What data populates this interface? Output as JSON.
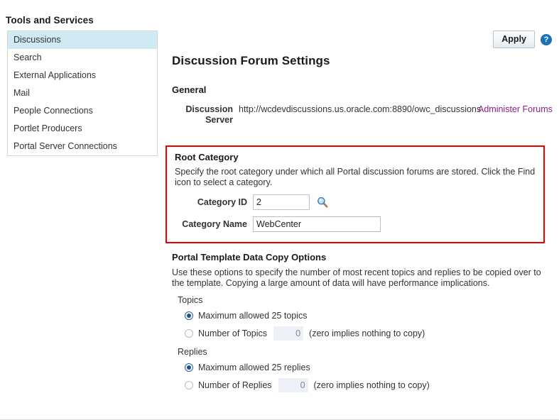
{
  "panel": {
    "title": "Tools and Services",
    "collapse_icon": "collapse-chevron-icon",
    "items": [
      {
        "label": "Discussions",
        "selected": true
      },
      {
        "label": "Search",
        "selected": false
      },
      {
        "label": "External Applications",
        "selected": false
      },
      {
        "label": "Mail",
        "selected": false
      },
      {
        "label": "People Connections",
        "selected": false
      },
      {
        "label": "Portlet Producers",
        "selected": false
      },
      {
        "label": "Portal Server Connections",
        "selected": false
      }
    ]
  },
  "toolbar": {
    "apply_label": "Apply",
    "help_icon": "help-question-icon",
    "help_glyph": "?"
  },
  "page": {
    "title": "Discussion Forum Settings"
  },
  "general": {
    "heading": "General",
    "discussion_server_label": "Discussion Server",
    "discussion_server_value": "http://wcdevdiscussions.us.oracle.com:8890/owc_discussions",
    "administer_link": "Administer Forums",
    "administer_link_color": "#8a1f8a"
  },
  "root_category": {
    "heading": "Root Category",
    "description": "Specify the root category under which all Portal discussion forums are stored. Click the Find icon to select a category.",
    "category_id_label": "Category ID",
    "category_id_value": "2",
    "category_name_label": "Category Name",
    "category_name_value": "WebCenter",
    "find_icon": "magnifier-find-icon",
    "highlight_color": "#ee0000"
  },
  "copy_options": {
    "heading": "Portal Template Data Copy Options",
    "description": "Use these options to specify the number of most recent topics and replies to be copied over to the template. Copying a large amount of data will have performance implications.",
    "topics": {
      "group_label": "Topics",
      "max_option_label": "Maximum allowed 25 topics",
      "max_selected": true,
      "number_option_label": "Number of Topics",
      "number_selected": false,
      "number_value": "0",
      "hint": "(zero implies nothing to copy)"
    },
    "replies": {
      "group_label": "Replies",
      "max_option_label": "Maximum allowed 25 replies",
      "max_selected": true,
      "number_option_label": "Number of Replies",
      "number_selected": false,
      "number_value": "0",
      "hint": "(zero implies nothing to copy)"
    }
  }
}
